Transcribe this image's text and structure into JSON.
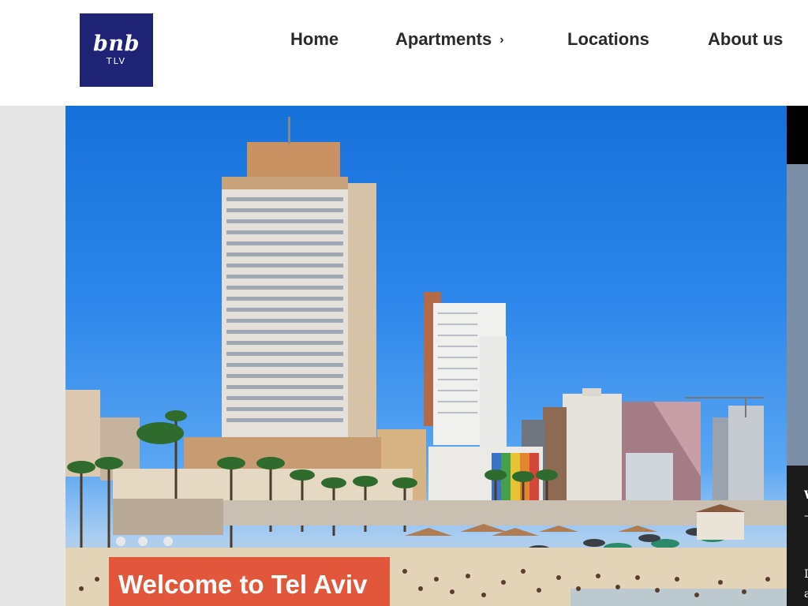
{
  "brand": {
    "logo_script": "bnb",
    "logo_sub": "TLV",
    "color": "#1f2376"
  },
  "nav": {
    "home": "Home",
    "apartments": "Apartments",
    "apartments_chevron": "›",
    "locations": "Locations",
    "about": "About us"
  },
  "hero": {
    "image": "tel-aviv-beach-skyline-photo",
    "caption": "Welcome to Tel Aviv",
    "caption_bg": "#e2573b"
  },
  "side_panel": {
    "fragments": [
      "W",
      "–",
      "D",
      "a"
    ]
  }
}
